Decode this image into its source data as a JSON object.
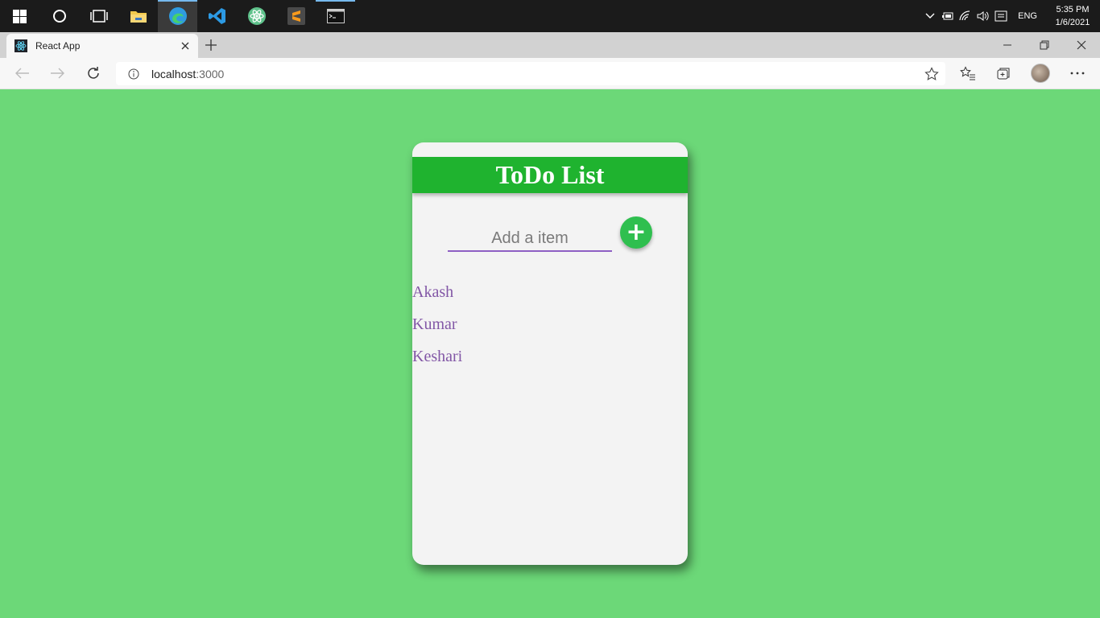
{
  "taskbar": {
    "apps": [
      "start-icon",
      "cortana-icon",
      "task-view-icon",
      "file-explorer-icon",
      "edge-icon",
      "vscode-icon",
      "atom-icon",
      "sublime-text-icon",
      "terminal-icon"
    ],
    "language": "ENG",
    "time": "5:35 PM",
    "date": "1/6/2021"
  },
  "browser": {
    "tab_title": "React App",
    "url_host": "localhost",
    "url_port": ":3000"
  },
  "app": {
    "title": "ToDo List",
    "input_placeholder": "Add a item",
    "add_button_label": "+",
    "items": [
      "Akash",
      "Kumar",
      "Keshari"
    ]
  },
  "colors": {
    "page_background": "#6cd878",
    "header_green": "#1fb32f",
    "button_green": "#2fbf4f",
    "item_purple": "#8257a6",
    "input_underline": "#8e5fc4"
  }
}
